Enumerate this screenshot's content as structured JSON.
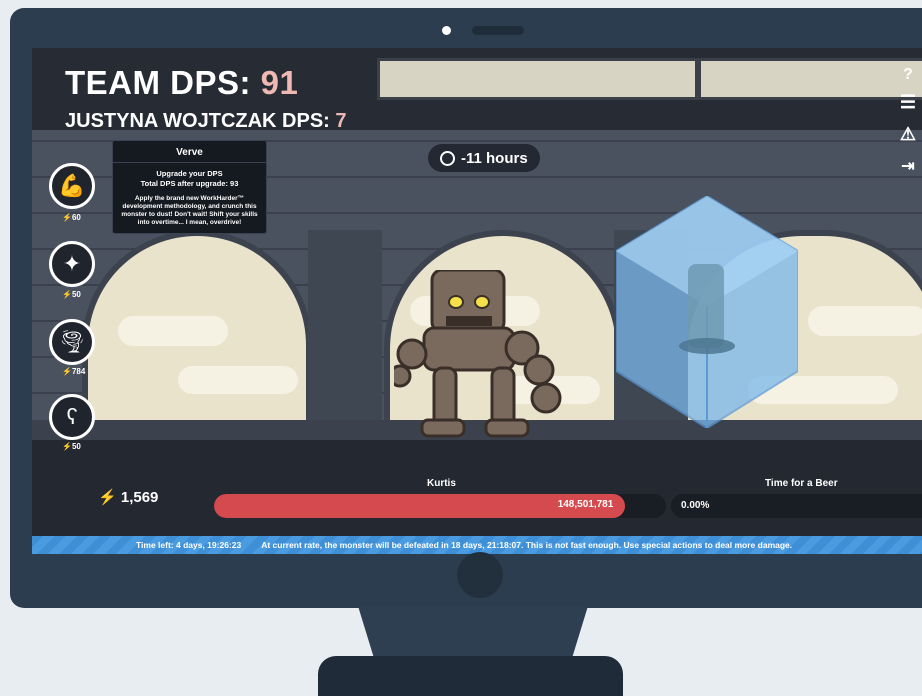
{
  "hud": {
    "team_dps_label": "TEAM DPS:",
    "team_dps_value": "91",
    "user_dps_label": "JUSTYNA WOJTCZAK DPS:",
    "user_dps_value": "7",
    "timer": "-11 hours"
  },
  "tooltip": {
    "title": "Verve",
    "line1": "Upgrade your DPS",
    "line2": "Total DPS after upgrade: 93",
    "description": "Apply the brand new WorkHarder™ development methodology, and crunch this monster to dust! Don't wait! Shift your skills into overtime... I mean, overdrive!"
  },
  "skills": [
    {
      "icon": "muscle-arm-icon",
      "cost": "60"
    },
    {
      "icon": "sparkles-icon",
      "cost": "50"
    },
    {
      "icon": "tornado-icon",
      "cost": "784"
    },
    {
      "icon": "bear-icon",
      "cost": "50"
    }
  ],
  "side_menu": [
    {
      "icon": "help-icon",
      "glyph": "?"
    },
    {
      "icon": "menu-icon",
      "glyph": "☰"
    },
    {
      "icon": "warning-icon",
      "glyph": "⚠"
    },
    {
      "icon": "logout-icon",
      "glyph": "⇥"
    }
  ],
  "battle": {
    "currency": "1,569",
    "monster_name": "Kurtis",
    "monster_hp": "148,501,781",
    "monster_hp_fraction": 0.91,
    "beer_label": "Time for a Beer",
    "beer_progress": "0.00%"
  },
  "status": {
    "time_left": "Time left: 4 days, 19:26:23",
    "message": "At current rate, the monster will be defeated in 18 days, 21:18:07. This is not fast enough. Use special actions to deal more damage."
  },
  "colors": {
    "accent_dps": "#f0b8b3",
    "hp_fill": "#d44a4f",
    "status_bar": "#3f8fd6",
    "bolt": "#f5b53b"
  }
}
